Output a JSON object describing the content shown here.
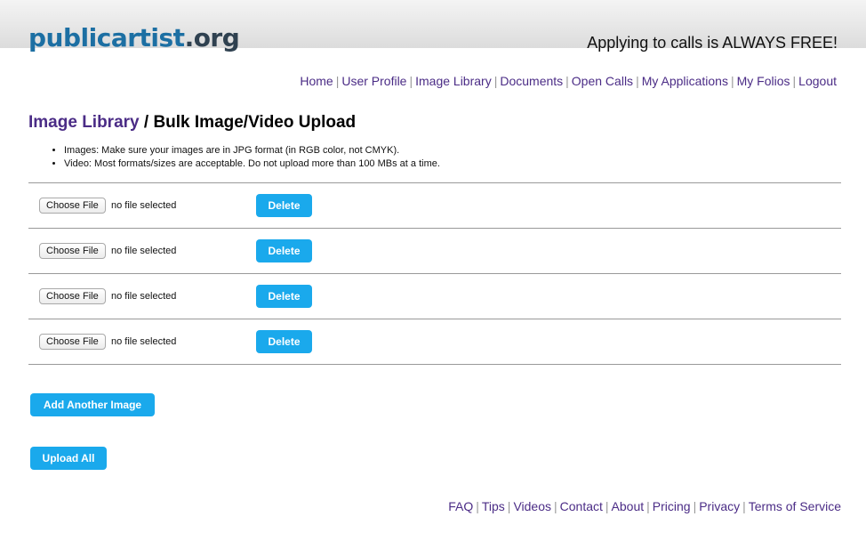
{
  "header": {
    "logo_part1": "public",
    "logo_part2": "artist",
    "logo_part3": ".org",
    "tagline": "Applying to calls is ALWAYS FREE!"
  },
  "nav": {
    "items": [
      "Home",
      "User Profile",
      "Image Library",
      "Documents",
      "Open Calls",
      "My Applications",
      "My Folios",
      "Logout"
    ],
    "separator": "|"
  },
  "page": {
    "breadcrumb_link": "Image Library",
    "title": " / Bulk Image/Video Upload",
    "notes": [
      "Images: Make sure your images are in JPG format (in RGB color, not CMYK).",
      "Video: Most formats/sizes are acceptable. Do not upload more than 100 MBs at a time."
    ]
  },
  "upload_rows": [
    {
      "choose_label": "Choose File",
      "status": "no file selected",
      "delete_label": "Delete"
    },
    {
      "choose_label": "Choose File",
      "status": "no file selected",
      "delete_label": "Delete"
    },
    {
      "choose_label": "Choose File",
      "status": "no file selected",
      "delete_label": "Delete"
    },
    {
      "choose_label": "Choose File",
      "status": "no file selected",
      "delete_label": "Delete"
    }
  ],
  "actions": {
    "add_another": "Add Another Image",
    "upload_all": "Upload All"
  },
  "footer": {
    "items": [
      "FAQ",
      "Tips",
      "Videos",
      "Contact",
      "About",
      "Pricing",
      "Privacy",
      "Terms of Service"
    ],
    "separator": "|"
  },
  "colors": {
    "accent_blue": "#1aa9ec",
    "link_purple": "#4b2c86",
    "logo_blue": "#1c6fa3",
    "logo_dark": "#2f4150"
  }
}
